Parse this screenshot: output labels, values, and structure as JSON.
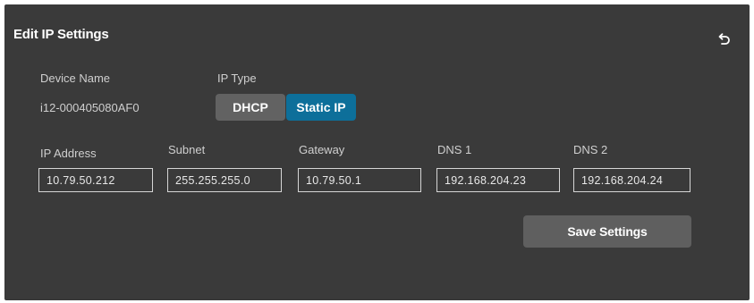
{
  "dialog": {
    "title": "Edit IP Settings",
    "undo_icon": "undo-arrow-icon"
  },
  "device": {
    "name_label": "Device Name",
    "name_value": "i12-000405080AF0"
  },
  "ip_type": {
    "label": "IP Type",
    "options": [
      "DHCP",
      "Static IP"
    ],
    "selected": "Static IP"
  },
  "fields": {
    "ip_address": {
      "label": "IP Address",
      "value": "10.79.50.212"
    },
    "subnet": {
      "label": "Subnet",
      "value": "255.255.255.0"
    },
    "gateway": {
      "label": "Gateway",
      "value": "10.79.50.1"
    },
    "dns1": {
      "label": "DNS 1",
      "value": "192.168.204.23"
    },
    "dns2": {
      "label": "DNS 2",
      "value": "192.168.204.24"
    }
  },
  "actions": {
    "save_label": "Save Settings"
  },
  "colors": {
    "panel_bg": "#3a3a3a",
    "selected_accent": "#0d6f9a",
    "unselected_segment": "#626262",
    "button_bg": "#5f5f5f"
  }
}
